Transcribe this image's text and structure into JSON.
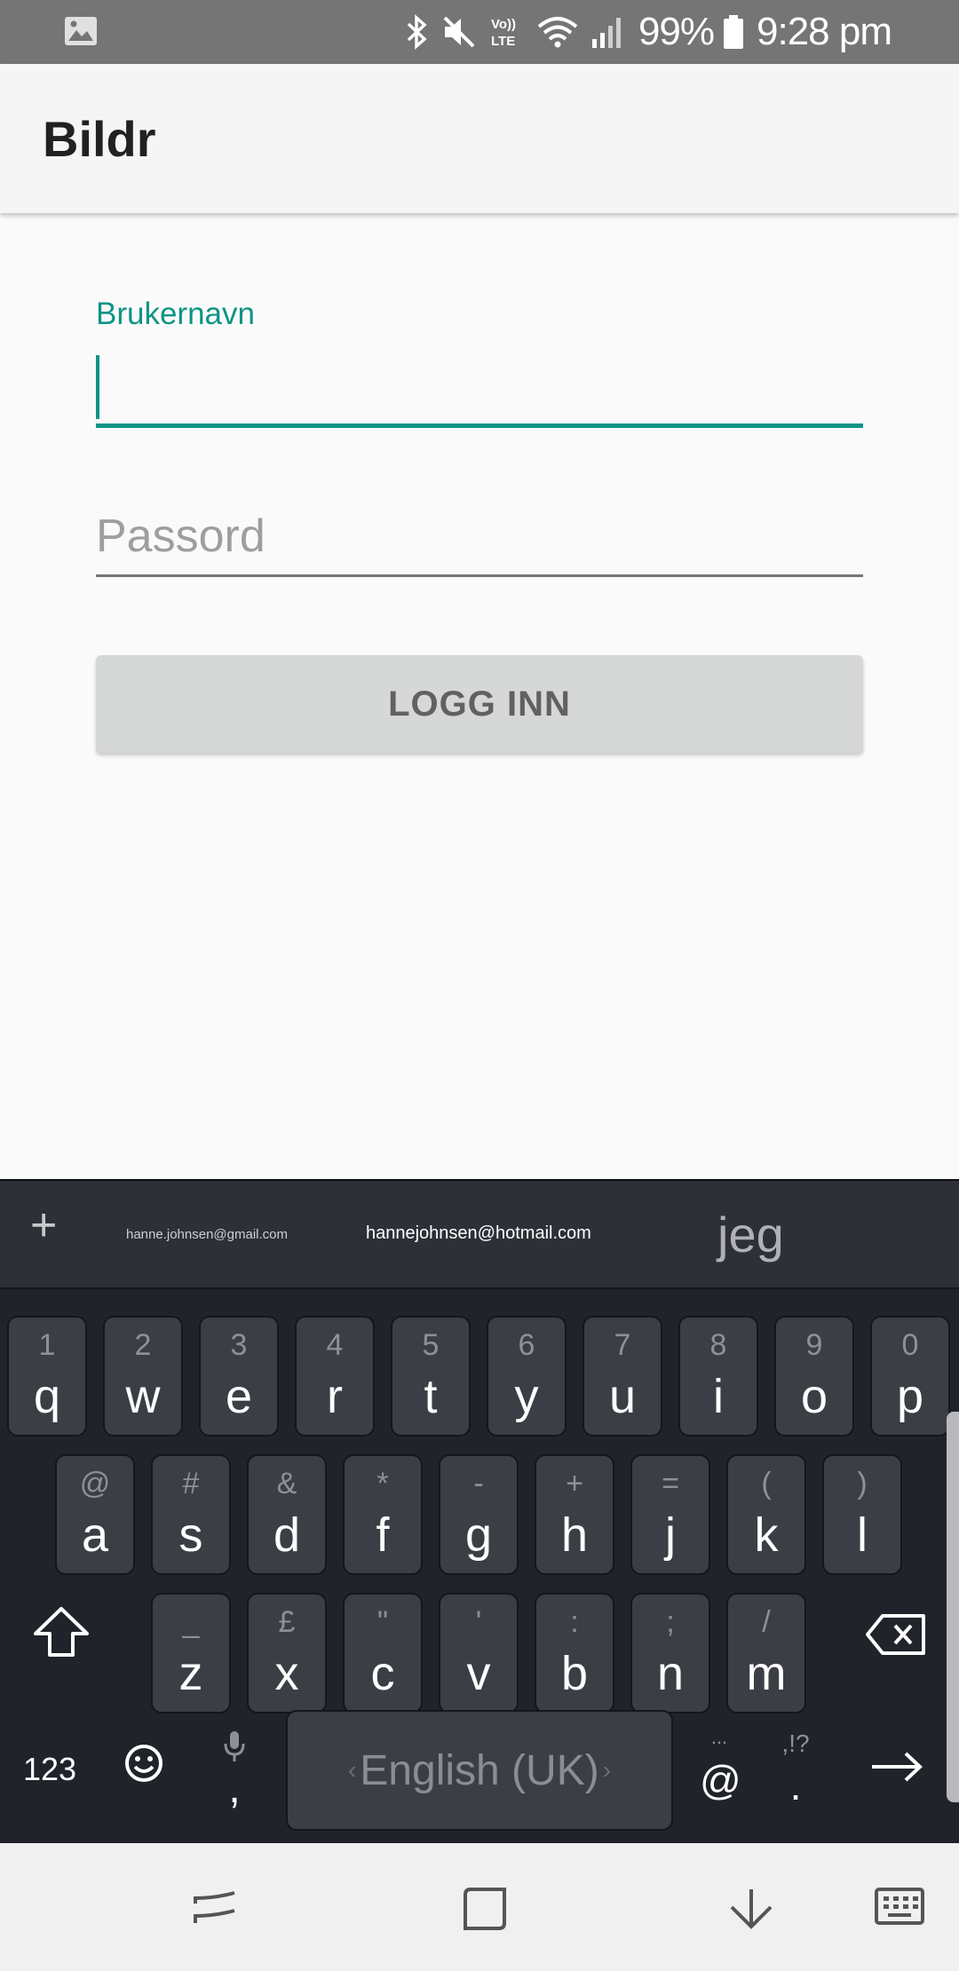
{
  "status_bar": {
    "battery": "99%",
    "time": "9:28 pm",
    "icons": [
      "image-icon",
      "bluetooth-icon",
      "mute-icon",
      "volte-icon",
      "wifi-icon",
      "signal-icon",
      "battery-icon"
    ],
    "volte_label": "Vo)) LTE"
  },
  "app_bar": {
    "title": "Bildr"
  },
  "form": {
    "username_label": "Brukernavn",
    "username_value": "",
    "password_placeholder": "Passord",
    "login_label": "LOGG INN",
    "accent_color": "#0f9486"
  },
  "keyboard": {
    "suggestions": {
      "plus": "+",
      "item1": "hanne.johnsen@gmail.com",
      "item2": "hannejohnsen@hotmail.com",
      "item3": "jeg"
    },
    "row1": [
      {
        "main": "q",
        "sub": "1"
      },
      {
        "main": "w",
        "sub": "2"
      },
      {
        "main": "e",
        "sub": "3"
      },
      {
        "main": "r",
        "sub": "4"
      },
      {
        "main": "t",
        "sub": "5"
      },
      {
        "main": "y",
        "sub": "6"
      },
      {
        "main": "u",
        "sub": "7"
      },
      {
        "main": "i",
        "sub": "8"
      },
      {
        "main": "o",
        "sub": "9"
      },
      {
        "main": "p",
        "sub": "0"
      }
    ],
    "row2": [
      {
        "main": "a",
        "sub": "@"
      },
      {
        "main": "s",
        "sub": "#"
      },
      {
        "main": "d",
        "sub": "&"
      },
      {
        "main": "f",
        "sub": "*"
      },
      {
        "main": "g",
        "sub": "-"
      },
      {
        "main": "h",
        "sub": "+"
      },
      {
        "main": "j",
        "sub": "="
      },
      {
        "main": "k",
        "sub": "("
      },
      {
        "main": "l",
        "sub": ")"
      }
    ],
    "row3": [
      {
        "main": "z",
        "sub": "_"
      },
      {
        "main": "x",
        "sub": "£"
      },
      {
        "main": "c",
        "sub": "\""
      },
      {
        "main": "v",
        "sub": "'"
      },
      {
        "main": "b",
        "sub": ":"
      },
      {
        "main": "n",
        "sub": ";"
      },
      {
        "main": "m",
        "sub": "/"
      }
    ],
    "bottom": {
      "numbers_label": "123",
      "comma": ",",
      "space_label": "English (UK)",
      "at": "@",
      "at_sub": "...",
      "period": ".",
      "period_sub": ",!?"
    }
  },
  "nav_bar": {
    "icons": [
      "recent-apps-icon",
      "home-icon",
      "hide-keyboard-icon",
      "keyboard-switch-icon"
    ]
  }
}
